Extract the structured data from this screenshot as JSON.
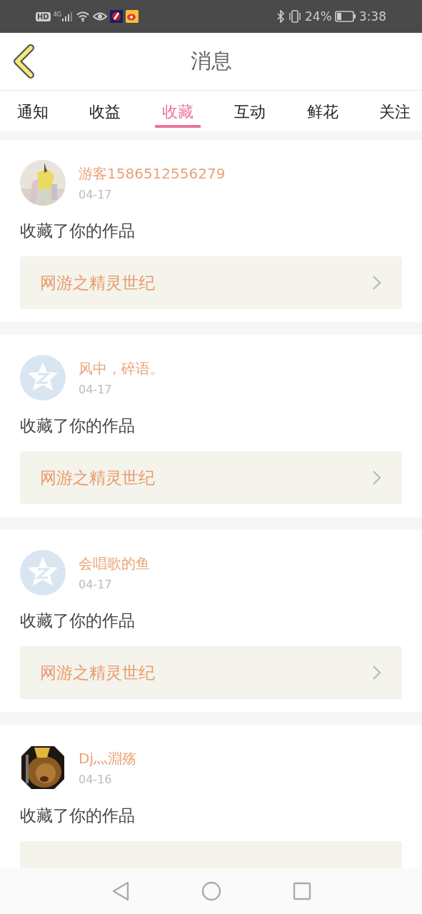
{
  "status_bar": {
    "badges": [
      "HD",
      "4G"
    ],
    "battery": "24%",
    "time": "3:38"
  },
  "header": {
    "title": "消息"
  },
  "tabs": [
    {
      "label": "通知",
      "selected": false
    },
    {
      "label": "收益",
      "selected": false
    },
    {
      "label": "收藏",
      "selected": true
    },
    {
      "label": "互动",
      "selected": false
    },
    {
      "label": "鲜花",
      "selected": false
    },
    {
      "label": "关注",
      "selected": false
    }
  ],
  "messages": [
    {
      "kind": "picture",
      "user": "游客1586512556279",
      "date": "04-17",
      "action": "收藏了你的作品",
      "work": "网游之精灵世纪"
    },
    {
      "kind": "default",
      "user": "风中，碎语。",
      "date": "04-17",
      "action": "收藏了你的作品",
      "work": "网游之精灵世纪"
    },
    {
      "kind": "default",
      "user": "会唱歌的鱼",
      "date": "04-17",
      "action": "收藏了你的作品",
      "work": "网游之精灵世纪"
    },
    {
      "kind": "picture",
      "user": "Dj灬淵殇",
      "date": "04-16",
      "action": "收藏了你的作品"
    }
  ]
}
